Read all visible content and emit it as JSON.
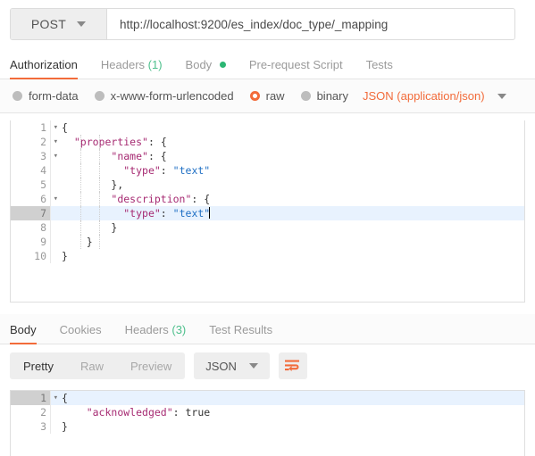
{
  "request": {
    "method": "POST",
    "method_caret_icon": "chevron-down-icon",
    "url": "http://localhost:9200/es_index/doc_type/_mapping",
    "tabs": [
      {
        "label": "Authorization",
        "count": "",
        "active": false,
        "dot": false
      },
      {
        "label": "Headers",
        "count": "(1)",
        "active": false,
        "dot": false
      },
      {
        "label": "Body",
        "count": "",
        "active": true,
        "dot": true
      },
      {
        "label": "Pre-request Script",
        "count": "",
        "active": false,
        "dot": false
      },
      {
        "label": "Tests",
        "count": "",
        "active": false,
        "dot": false
      }
    ],
    "body_types": [
      {
        "label": "form-data",
        "selected": false
      },
      {
        "label": "x-www-form-urlencoded",
        "selected": false
      },
      {
        "label": "raw",
        "selected": true
      },
      {
        "label": "binary",
        "selected": false
      }
    ],
    "content_type": "JSON (application/json)",
    "content_type_caret_icon": "chevron-down-icon",
    "body_lines": [
      {
        "num": "1",
        "fold": "▾",
        "text": "{"
      },
      {
        "num": "2",
        "fold": "▾",
        "text": "  \"properties\": {"
      },
      {
        "num": "3",
        "fold": "▾",
        "text": "        \"name\": {"
      },
      {
        "num": "4",
        "fold": "",
        "text": "          \"type\": \"text\""
      },
      {
        "num": "5",
        "fold": "",
        "text": "        },"
      },
      {
        "num": "6",
        "fold": "▾",
        "text": "        \"description\": {"
      },
      {
        "num": "7",
        "fold": "",
        "text": "          \"type\": \"text\"",
        "active": true
      },
      {
        "num": "8",
        "fold": "",
        "text": "        }"
      },
      {
        "num": "9",
        "fold": "",
        "text": "    }"
      },
      {
        "num": "10",
        "fold": "",
        "text": "}"
      }
    ]
  },
  "response": {
    "tabs": [
      {
        "label": "Body",
        "count": "",
        "active": true
      },
      {
        "label": "Cookies",
        "count": "",
        "active": false
      },
      {
        "label": "Headers",
        "count": "(3)",
        "active": false
      },
      {
        "label": "Test Results",
        "count": "",
        "active": false
      }
    ],
    "view_modes": [
      {
        "label": "Pretty",
        "active": true
      },
      {
        "label": "Raw",
        "active": false
      },
      {
        "label": "Preview",
        "active": false
      }
    ],
    "format": "JSON",
    "format_caret_icon": "chevron-down-icon",
    "wrap_icon": "word-wrap-icon",
    "body_lines": [
      {
        "num": "1",
        "fold": "▾",
        "text": "{",
        "active": true
      },
      {
        "num": "2",
        "fold": "",
        "text": "    \"acknowledged\": true"
      },
      {
        "num": "3",
        "fold": "",
        "text": "}"
      }
    ]
  },
  "colors": {
    "accent": "#f26b3a",
    "green": "#2bb673",
    "key": "#a62a72",
    "string": "#1f6fc4",
    "active_line": "#e8f2fe"
  }
}
